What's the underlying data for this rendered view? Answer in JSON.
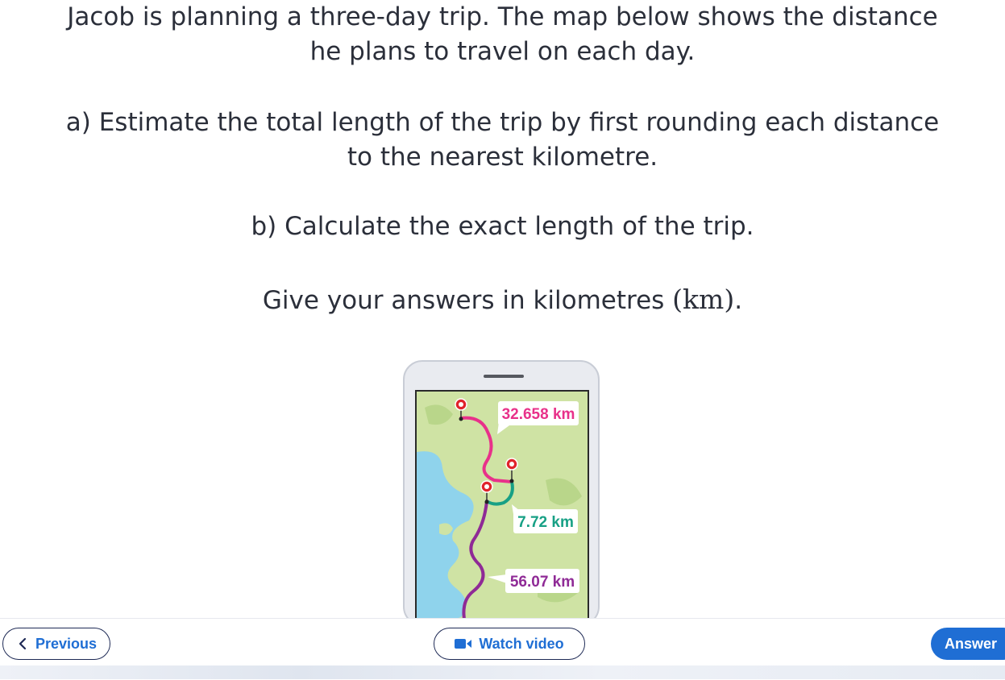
{
  "question": {
    "intro_line1": "Jacob is planning a three-day trip. The map below shows the distance",
    "intro_line2": "he plans to travel on each day.",
    "part_a_line1": "a) Estimate the total length of the trip by first rounding each distance",
    "part_a_line2": "to the nearest kilometre.",
    "part_b": "b) Calculate the exact length of the trip.",
    "units_prefix": "Give your answers in kilometres ",
    "units_math": "(km)",
    "units_suffix": "."
  },
  "map": {
    "day1_distance": "32.658 km",
    "day2_distance": "7.72 km",
    "day3_distance": "56.07 km",
    "colors": {
      "day1": "#e8318a",
      "day2": "#17a085",
      "day3": "#8f2a96",
      "land": "#cfe3a4",
      "water": "#8fd3ec",
      "marker": "#e0242b"
    }
  },
  "footer": {
    "previous_label": "Previous",
    "watch_video_label": "Watch video",
    "answer_label": "Answer",
    "icons": [
      "chevron-left-icon",
      "video-camera-icon"
    ]
  }
}
